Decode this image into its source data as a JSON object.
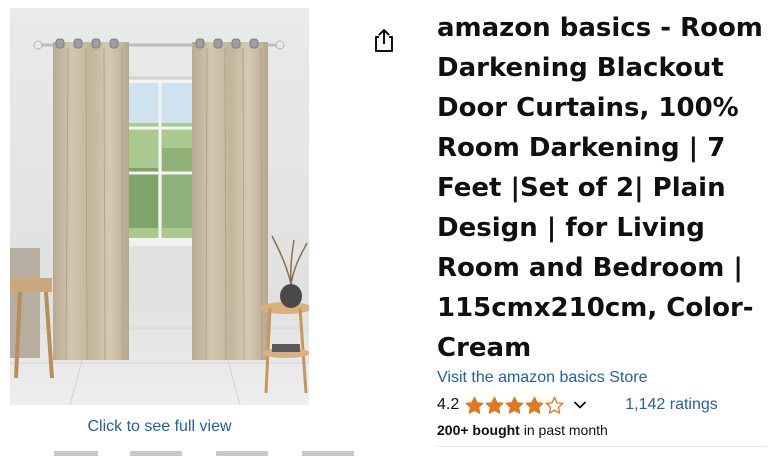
{
  "product": {
    "title": "amazon basics - Room Darkening Blackout Door Curtains, 100% Room Darkening | 7 Feet |Set of 2| Plain Design | for Living Room and Bedroom | 115cmx210cm, Color-Cream",
    "store_link": "Visit the amazon basics Store",
    "rating_value": "4.2",
    "rating_stars": 4.2,
    "ratings_count": "1,142 ratings",
    "bought_bold": "200+ bought",
    "bought_rest": " in past month"
  },
  "image": {
    "full_view_label": "Click to see full view"
  },
  "colors": {
    "link": "#2162a1",
    "star": "#de7921",
    "text": "#0f1111"
  },
  "icons": {
    "share": "share-icon",
    "star": "star-icon",
    "chevron": "chevron-down-icon"
  }
}
